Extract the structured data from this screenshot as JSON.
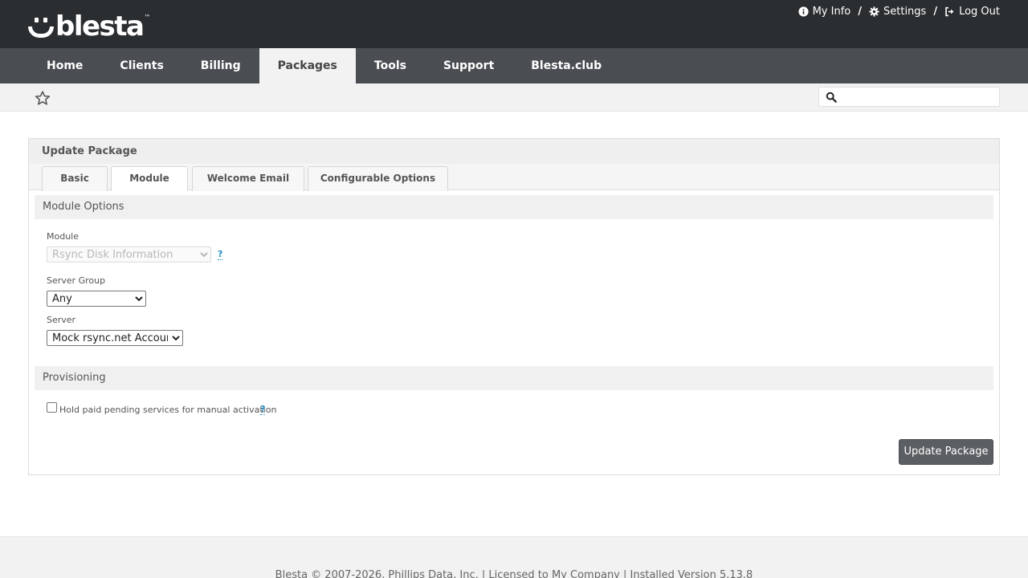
{
  "brand": {
    "name": "blesta",
    "tm": "™"
  },
  "top_links": [
    {
      "label": "My Info",
      "icon": "info-circle-icon"
    },
    {
      "label": "Settings",
      "icon": "gear-icon"
    },
    {
      "label": "Log Out",
      "icon": "sign-out-icon"
    }
  ],
  "top_links_separator": "/",
  "nav": {
    "items": [
      "Home",
      "Clients",
      "Billing",
      "Packages",
      "Tools",
      "Support",
      "Blesta.club"
    ],
    "active": "Packages"
  },
  "search": {
    "placeholder": "",
    "value": ""
  },
  "panel": {
    "title": "Update Package",
    "tabs": [
      "Basic",
      "Module",
      "Welcome Email",
      "Configurable Options"
    ],
    "active_tab": "Module",
    "module_options": {
      "heading": "Module Options",
      "module_label": "Module",
      "module_value": "Rsync Disk Information",
      "help": "?",
      "server_group_label": "Server Group",
      "server_group_value": "Any",
      "server_label": "Server",
      "server_value": "Mock rsync.net Account"
    },
    "provisioning": {
      "heading": "Provisioning",
      "hold_label": "Hold paid pending services for manual activation",
      "hold_checked": false,
      "help": "?"
    },
    "submit_label": "Update Package"
  },
  "footer": {
    "text": "Blesta © 2007-2026, Phillips Data, Inc. | Licensed to My Company | Installed Version 5.13.8"
  },
  "colors": {
    "header_bg": "#2b2e31",
    "nav_bg": "#4a4e52",
    "button_bg": "#5b5f63",
    "help_link": "#1c8dc9"
  }
}
